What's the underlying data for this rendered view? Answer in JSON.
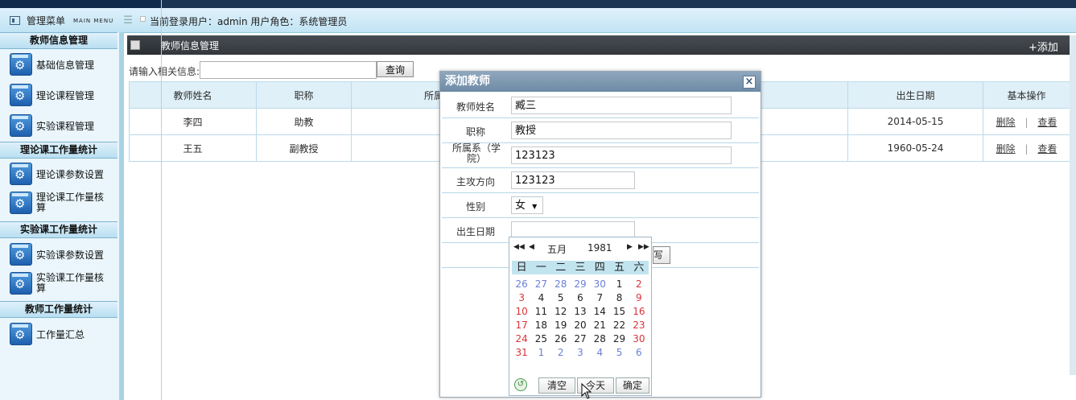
{
  "topbar": {
    "menu_title": "管理菜单",
    "menu_sub": "MAIN MENU",
    "current_user": "当前登录用户：admin 用户角色：系统管理员"
  },
  "sidebar": {
    "sections": [
      {
        "title": "教师信息管理",
        "items": [
          "基础信息管理",
          "理论课程管理",
          "实验课程管理"
        ]
      },
      {
        "title": "理论课工作量统计",
        "items": [
          "理论课参数设置",
          "理论课工作量核算"
        ]
      },
      {
        "title": "实验课工作量统计",
        "items": [
          "实验课参数设置",
          "实验课工作量核算"
        ]
      },
      {
        "title": "教师工作量统计",
        "items": [
          "工作量汇总"
        ]
      }
    ]
  },
  "main": {
    "header_title": "教师信息管理",
    "add_label": "+添加",
    "search_label": "请输入相关信息:",
    "search_placeholder": "",
    "search_button": "查询",
    "columns": [
      "教师姓名",
      "职称",
      "所属",
      "出生日期",
      "基本操作"
    ],
    "rows": [
      {
        "name": "李四",
        "title": "助教",
        "dept": "",
        "birth": "2014-05-15",
        "del": "删除",
        "view": "查看"
      },
      {
        "name": "王五",
        "title": "副教授",
        "dept": "",
        "birth": "1960-05-24",
        "del": "删除",
        "view": "查看"
      }
    ],
    "op_separator": "|"
  },
  "dialog": {
    "title": "添加教师",
    "close_glyph": "×",
    "fields": [
      {
        "label": "教师姓名",
        "value": "臧三"
      },
      {
        "label": "职称",
        "value": "教授"
      },
      {
        "label": "所属系（学院）",
        "value": "123123"
      },
      {
        "label": "主攻方向",
        "value": "123123"
      },
      {
        "label": "性别",
        "value": "女"
      },
      {
        "label": "出生日期",
        "value": ""
      }
    ],
    "submit_fragment": "写"
  },
  "calendar": {
    "prev_year": "◀◀",
    "prev_month": "◀",
    "month": "五月",
    "year": "1981",
    "next_month": "▶",
    "next_year": "▶▶",
    "weekdays": [
      "日",
      "一",
      "二",
      "三",
      "四",
      "五",
      "六"
    ],
    "days": [
      [
        "26",
        "27",
        "28",
        "29",
        "30",
        "1",
        "2"
      ],
      [
        "3",
        "4",
        "5",
        "6",
        "7",
        "8",
        "9"
      ],
      [
        "10",
        "11",
        "12",
        "13",
        "14",
        "15",
        "16"
      ],
      [
        "17",
        "18",
        "19",
        "20",
        "21",
        "22",
        "23"
      ],
      [
        "24",
        "25",
        "26",
        "27",
        "28",
        "29",
        "30"
      ],
      [
        "31",
        "1",
        "2",
        "3",
        "4",
        "5",
        "6"
      ]
    ],
    "clear_label": "清空",
    "today_label": "今天",
    "ok_label": "确定"
  },
  "colors": {
    "accent": "#6e8aa5",
    "header_dark": "#2f3338",
    "sidebar_bg": "#eaf6fb",
    "weekend": "#d9343a",
    "other_month": "#6a7fd6"
  }
}
